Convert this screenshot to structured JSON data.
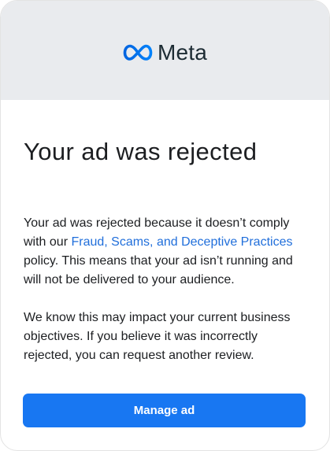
{
  "header": {
    "logo_text": "Meta",
    "logo_icon": "meta-infinity-logo",
    "logo_color": "#0668e1"
  },
  "notice": {
    "title": "Your ad was rejected",
    "paragraph1_before": "Your ad was rejected because it doesn’t comply with our ",
    "policy_link": "Fraud, Scams, and Deceptive Practices",
    "paragraph1_after": " policy. This means that your ad isn’t running and will not be delivered to your audience.",
    "paragraph2": "We know this may impact your current business objectives. If you believe it was incorrectly rejected, you can request another review."
  },
  "actions": {
    "manage_ad_label": "Manage ad"
  },
  "colors": {
    "header_bg": "#e9ebee",
    "link": "#216fdb",
    "button": "#1877f2"
  }
}
